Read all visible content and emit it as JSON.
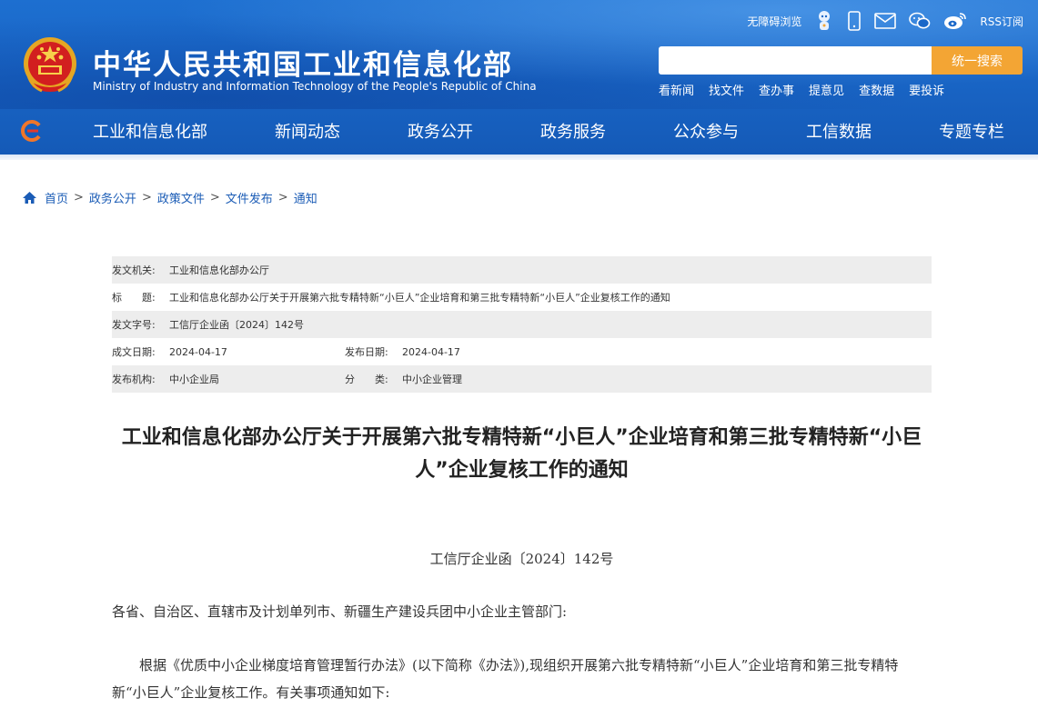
{
  "header": {
    "site_title_cn": "中华人民共和国工业和信息化部",
    "site_title_en": "Ministry of Industry and Information Technology of the People's Republic of China",
    "tools": {
      "accessible_label": "无障碍浏览",
      "rss_label": "RSS订阅"
    },
    "search": {
      "placeholder": "",
      "button_label": "统一搜索"
    },
    "quick_links": [
      "看新闻",
      "找文件",
      "查办事",
      "提意见",
      "查数据",
      "要投诉"
    ],
    "nav": [
      "工业和信息化部",
      "新闻动态",
      "政务公开",
      "政务服务",
      "公众参与",
      "工信数据",
      "专题专栏"
    ],
    "colors": {
      "primary_blue": "#1a67c8",
      "search_button": "#f3a534"
    }
  },
  "breadcrumb": [
    "首页",
    "政务公开",
    "政策文件",
    "文件发布",
    "通知"
  ],
  "info": {
    "issuer_label": "发文机关:",
    "issuer": "工业和信息化部办公厅",
    "title_label": "标　　题:",
    "title": "工业和信息化部办公厅关于开展第六批专精特新“小巨人”企业培育和第三批专精特新“小巨人”企业复核工作的通知",
    "doc_no_label": "发文字号:",
    "doc_no": "工信厅企业函〔2024〕142号",
    "created_label": "成文日期:",
    "created": "2024-04-17",
    "published_label": "发布日期:",
    "published": "2024-04-17",
    "org_label": "发布机构:",
    "org": "中小企业局",
    "category_label": "分　　类:",
    "category": "中小企业管理"
  },
  "article": {
    "title": "工业和信息化部办公厅关于开展第六批专精特新“小巨人”企业培育和第三批专精特新“小巨人”企业复核工作的通知",
    "doc_number": "工信厅企业函〔2024〕142号",
    "salutation": "各省、自治区、直辖市及计划单列市、新疆生产建设兵团中小企业主管部门:",
    "paragraph_1": "根据《优质中小企业梯度培育管理暂行办法》(以下简称《办法》),现组织开展第六批专精特新“小巨人”企业培育和第三批专精特新“小巨人”企业复核工作。有关事项通知如下:"
  }
}
